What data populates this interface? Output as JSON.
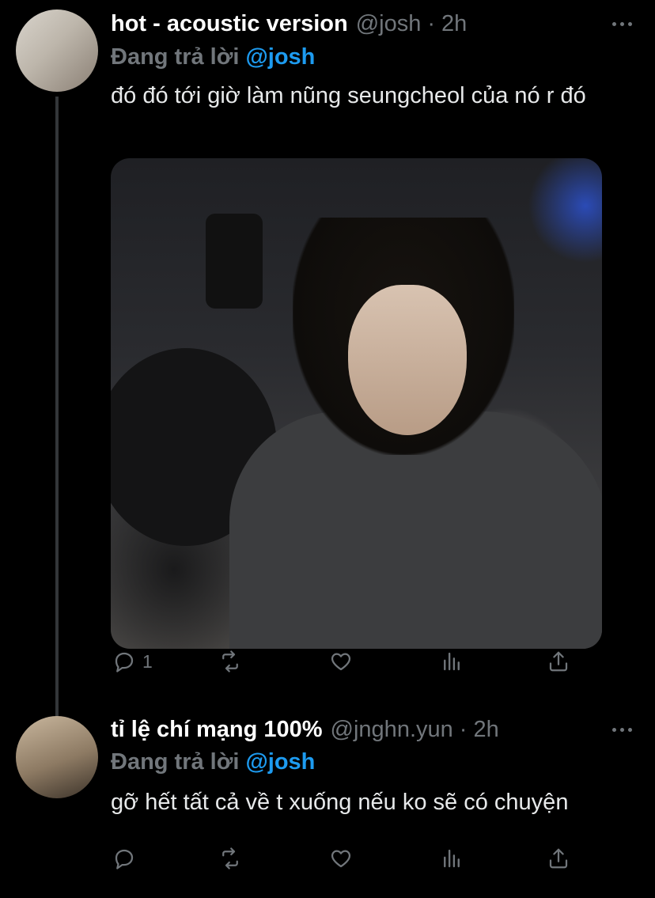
{
  "tweets": [
    {
      "display_name": "hot - acoustic version",
      "handle": "@josh",
      "dot": "·",
      "time": "2h",
      "replying_prefix": "Đang trả lời",
      "replying_to": "@josh",
      "text": "đó đó tới giờ làm nũng seungcheol của nó r đó",
      "reply_count": "1"
    },
    {
      "display_name": "tỉ lệ chí mạng 100%",
      "handle": "@jnghn.yun",
      "dot": "·",
      "time": "2h",
      "replying_prefix": "Đang trả lời",
      "replying_to": "@josh",
      "text": "gỡ hết tất cả về t xuống nếu ko sẽ có chuyện",
      "reply_count": ""
    }
  ],
  "colors": {
    "background": "#000000",
    "muted": "#71767b",
    "mention": "#1d9bf0",
    "thread_line": "#333639"
  },
  "icons": [
    "reply-icon",
    "retweet-icon",
    "like-icon",
    "views-icon",
    "share-icon",
    "more-icon"
  ]
}
